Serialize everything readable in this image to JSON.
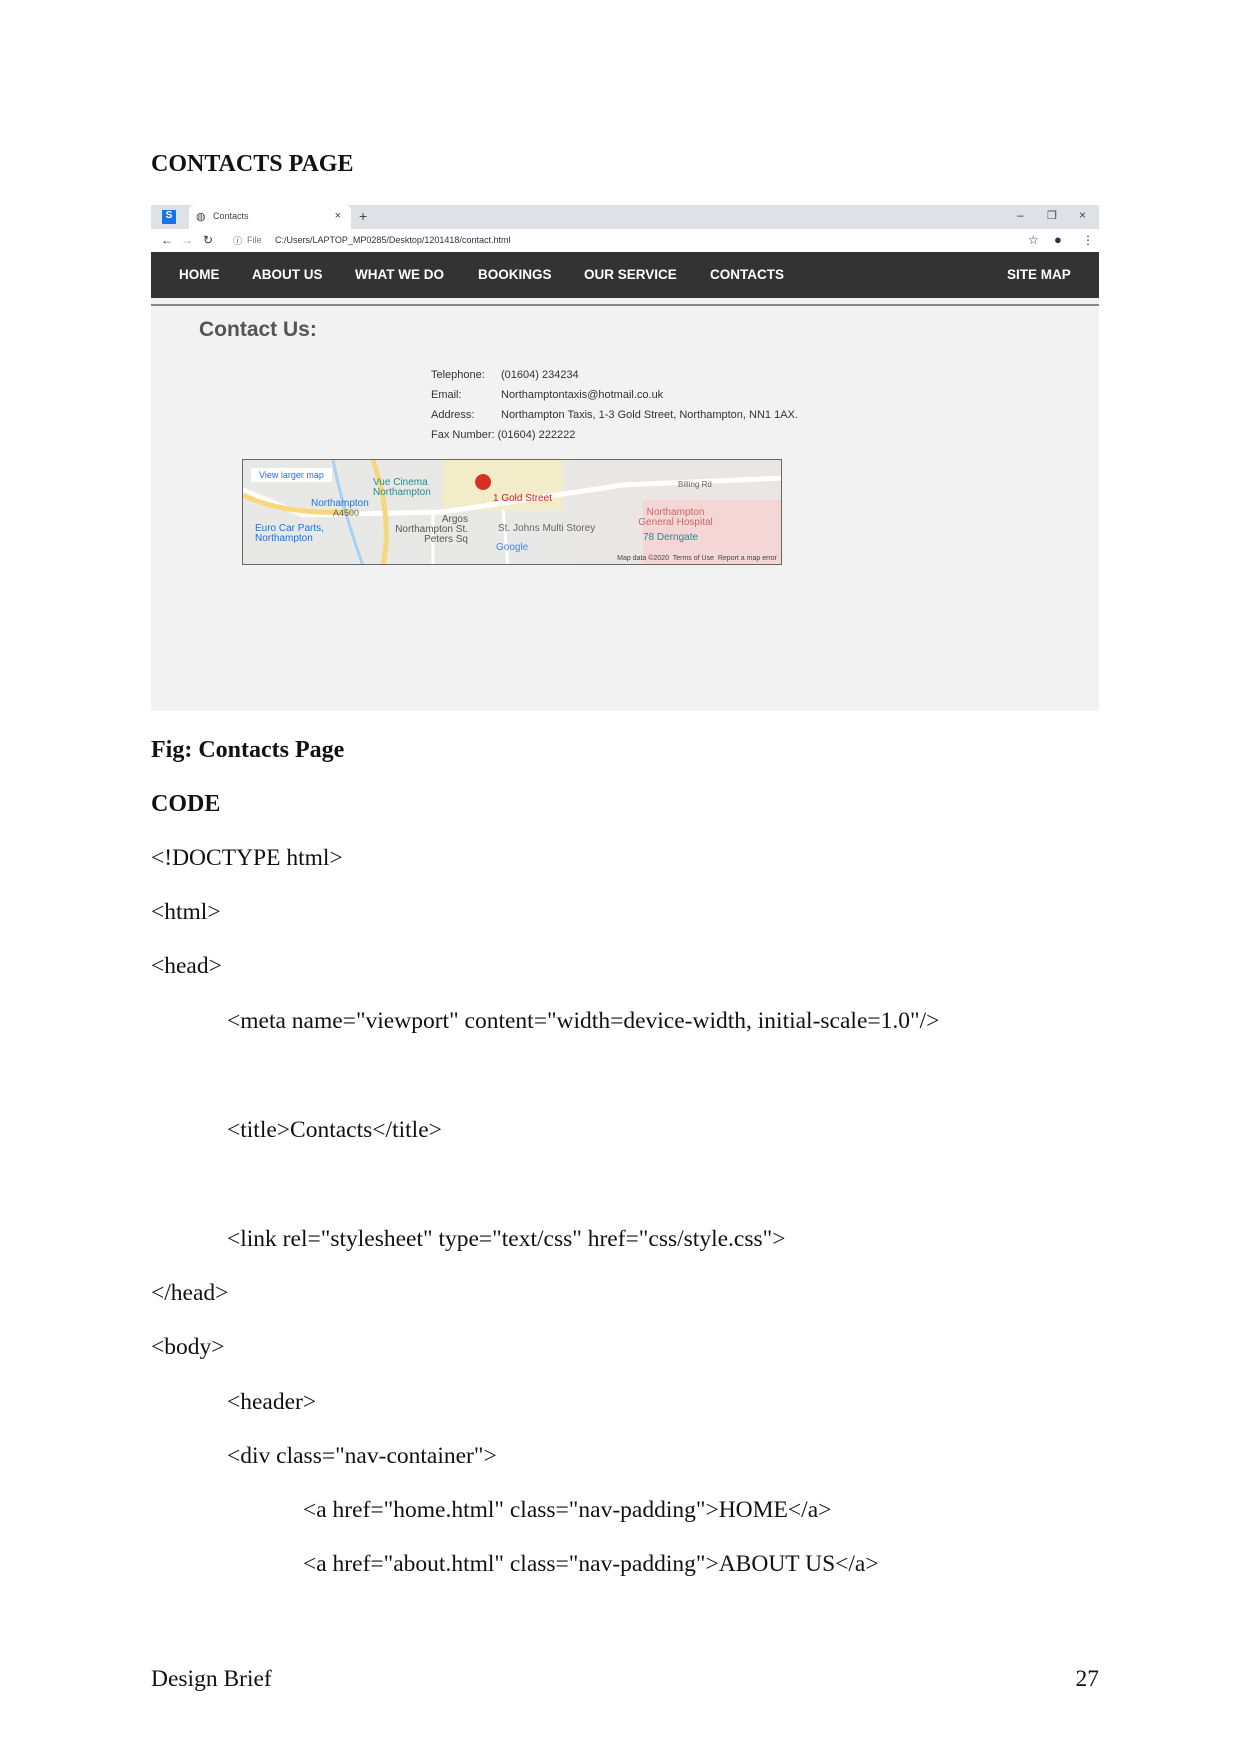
{
  "section_title": "CONTACTS PAGE",
  "screenshot": {
    "tab_title": "Contacts",
    "address_prefix": "File",
    "url": "C:/Users/LAPTOP_MP0285/Desktop/1201418/contact.html",
    "nav": [
      "HOME",
      "ABOUT US",
      "WHAT WE DO",
      "BOOKINGS",
      "OUR SERVICE",
      "CONTACTS"
    ],
    "nav_right": "SITE MAP",
    "heading": "Contact Us:",
    "info": [
      {
        "label": "Telephone:",
        "value": "(01604) 234234"
      },
      {
        "label": "Email:",
        "value": "Northamptontaxis@hotmail.co.uk"
      },
      {
        "label": "Address:",
        "value": "Northampton Taxis, 1-3 Gold Street, Northampton, NN1 1AX."
      },
      {
        "label": "Fax Number:",
        "value": "(01604) 222222"
      }
    ],
    "map": {
      "view_larger": "View larger map",
      "pin_label": "1 Gold Street",
      "places": [
        "Vue Cinema Northampton",
        "Northampton",
        "Argos Northampton St. Peters Sq",
        "St. Johns Multi Storey",
        "Euro Car Parts, Northampton",
        "Northampton General Hospital",
        "78 Derngate",
        "A4500",
        "Billing Rd"
      ],
      "google": "Google",
      "footer": "Map data ©2020  Terms of Use  Report a map error"
    }
  },
  "caption": "Fig: Contacts Page",
  "code_title": "CODE",
  "code_lines": [
    "<!DOCTYPE html>",
    "<html>",
    "<head>",
    "<meta name=\"viewport\" content=\"width=device-width, initial-scale=1.0\"/>",
    "<title>Contacts</title>",
    "<link rel=\"stylesheet\" type=\"text/css\" href=\"css/style.css\">",
    "</head>",
    "<body>",
    "<header>",
    "<div class=\"nav-container\">",
    "<a href=\"home.html\" class=\"nav-padding\">HOME</a>",
    "<a href=\"about.html\" class=\"nav-padding\">ABOUT US</a>"
  ],
  "footer": {
    "left": "Design Brief",
    "page": "27"
  }
}
